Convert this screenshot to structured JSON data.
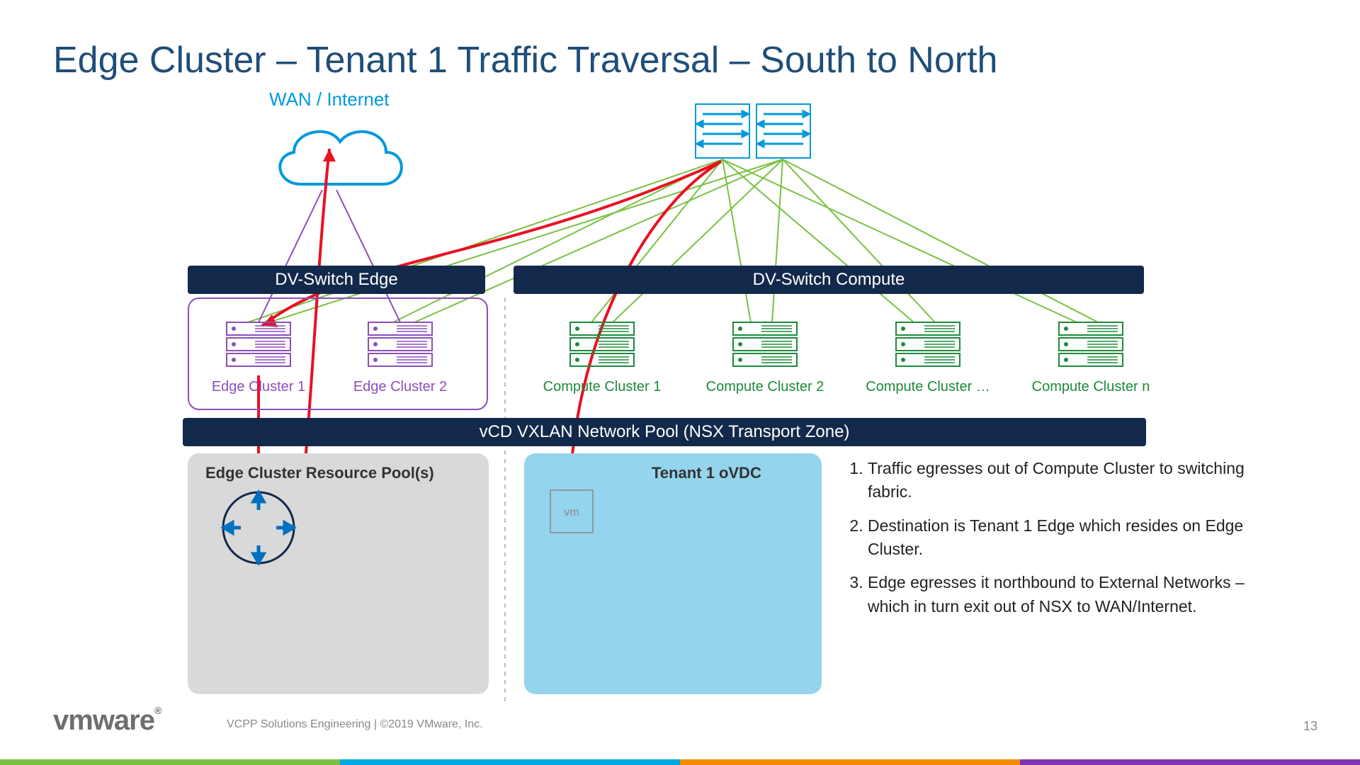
{
  "title": "Edge Cluster – Tenant 1 Traffic Traversal – South to North",
  "wan": "WAN / Internet",
  "bars": {
    "dv_edge": "DV-Switch Edge",
    "dv_compute": "DV-Switch Compute",
    "vxlan": "vCD VXLAN Network Pool (NSX Transport Zone)"
  },
  "clusters": {
    "edge1": "Edge Cluster 1",
    "edge2": "Edge Cluster 2",
    "comp1": "Compute Cluster 1",
    "comp2": "Compute Cluster 2",
    "compD": "Compute Cluster …",
    "compN": "Compute Cluster n"
  },
  "pools": {
    "edge": "Edge Cluster Resource Pool(s)",
    "tenant": "Tenant 1 oVDC"
  },
  "vm": "vm",
  "bullets": [
    "Traffic egresses out of Compute Cluster to switching fabric.",
    "Destination is Tenant 1 Edge which resides on Edge Cluster.",
    "Edge egresses it northbound to External Networks – which in turn exit out of NSX to WAN/Internet."
  ],
  "footer": {
    "logo": "vmware",
    "text": "VCPP Solutions Engineering   |   ©2019 VMware, Inc.",
    "slide": "13"
  },
  "colors": {
    "title": "#1F4E79",
    "blue": "#0099DA",
    "navy": "#13294B",
    "purple": "#8C4FB8",
    "green": "#1E8A3B",
    "greenLine": "#7AC142",
    "red": "#E81123",
    "tenantBg": "#94D4EC",
    "edgeBg": "#D9D9D9"
  }
}
